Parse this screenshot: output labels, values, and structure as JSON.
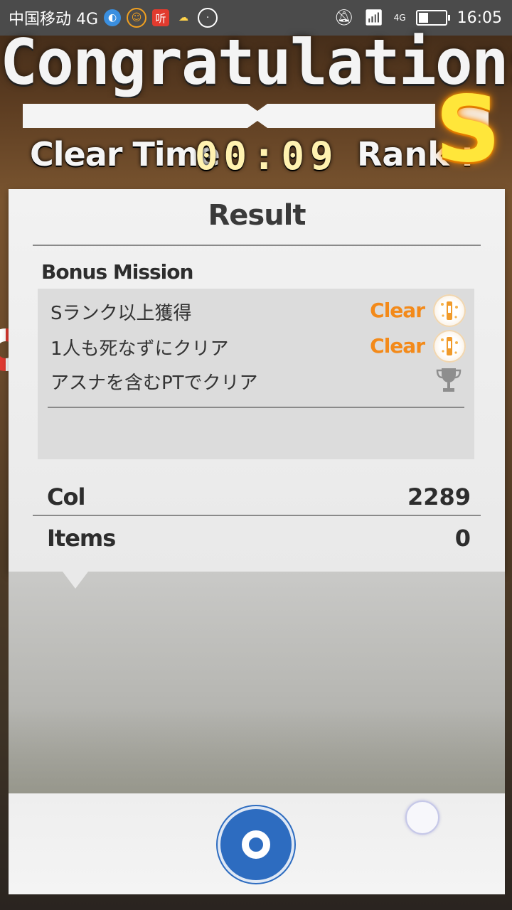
{
  "status_bar": {
    "carrier": "中国移动 4G",
    "ting_badge": "听",
    "network": "4G",
    "time": "16:05",
    "battery_level": 0.35
  },
  "header": {
    "title": "Congratulations!!",
    "clear_time_label": "Clear Time",
    "clear_time_value": "00:09",
    "rank_label": "Rank :",
    "rank_value": "S"
  },
  "result": {
    "title": "Result",
    "bonus_title": "Bonus Mission",
    "missions": [
      {
        "label": "Sランク以上獲得",
        "status": "Clear",
        "icon": "medal-icon"
      },
      {
        "label": "1人も死なずにクリア",
        "status": "Clear",
        "icon": "medal-icon"
      },
      {
        "label": "アスナを含むPTでクリア",
        "status": "",
        "icon": "trophy-icon"
      }
    ],
    "stats": [
      {
        "label": "Col",
        "value": "2289"
      },
      {
        "label": "Items",
        "value": "0"
      }
    ]
  },
  "colors": {
    "accent_orange": "#f38a1a",
    "rank_yellow": "#ffe63a",
    "record_blue": "#2d6cc0"
  }
}
